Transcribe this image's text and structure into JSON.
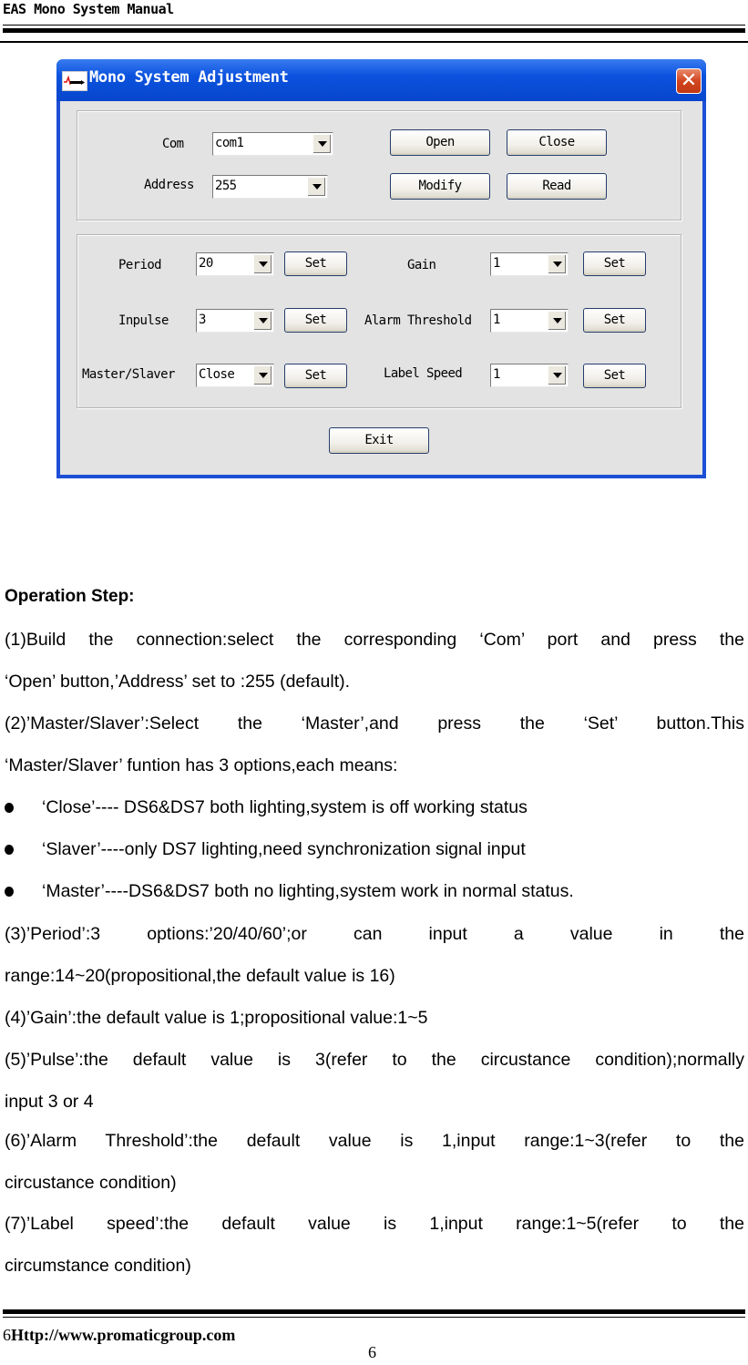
{
  "header": {
    "title": "EAS Mono System Manual"
  },
  "dialog": {
    "title": "Mono System Adjustment",
    "close_icon": "close-x-icon",
    "connection": {
      "com_label": "Com",
      "com_value": "com1",
      "address_label": "Address",
      "address_value": "255",
      "open_label": "Open",
      "close_label": "Close",
      "modify_label": "Modify",
      "read_label": "Read"
    },
    "settings": {
      "period": {
        "label": "Period",
        "value": "20",
        "button": "Set"
      },
      "inpulse": {
        "label": "Inpulse",
        "value": "3",
        "button": "Set"
      },
      "master_slaver": {
        "label": "Master/Slaver",
        "value": "Close",
        "button": "Set"
      },
      "gain": {
        "label": "Gain",
        "value": "1",
        "button": "Set"
      },
      "alarm_threshold": {
        "label": "Alarm Threshold",
        "value": "1",
        "button": "Set"
      },
      "label_speed": {
        "label": "Label Speed",
        "value": "1",
        "button": "Set"
      }
    },
    "exit_label": "Exit"
  },
  "body": {
    "heading": "Operation Step:",
    "step1": [
      "(1)Build the connection:select the corresponding ‘Com’ port and press the",
      "‘Open’ button,’Address’ set to :255 (default)."
    ],
    "step2": [
      "(2)’Master/Slaver’:Select the ‘Master’,and press the ‘Set’ button.This",
      "‘Master/Slaver’ funtion has 3 options,each means:"
    ],
    "bullets": [
      "‘Close’---- DS6&DS7 both lighting,system is off working status",
      "‘Slaver’----only DS7 lighting,need synchronization signal input",
      "‘Master’----DS6&DS7 both no lighting,system work in normal status."
    ],
    "step3": [
      "(3)’Period’:3 options:’20/40/60’;or can input a value in the",
      "range:14~20(propositional,the default value is 16)"
    ],
    "step4": "(4)’Gain’:the default value is 1;propositional value:1~5",
    "step5": [
      "(5)’Pulse’:the default value is 3(refer to the circustance condition);normally",
      "input 3 or 4"
    ],
    "step6": [
      "(6)’Alarm Threshold’:the default value is 1,input range:1~3(refer to the",
      "circustance condition)"
    ],
    "step7": [
      "(7)’Label speed’:the default value is 1,input range:1~5(refer to the",
      "circumstance condition)"
    ]
  },
  "footer": {
    "page_prefix": "6",
    "url": "Http://www.promaticgroup.com",
    "page_number": "6"
  }
}
